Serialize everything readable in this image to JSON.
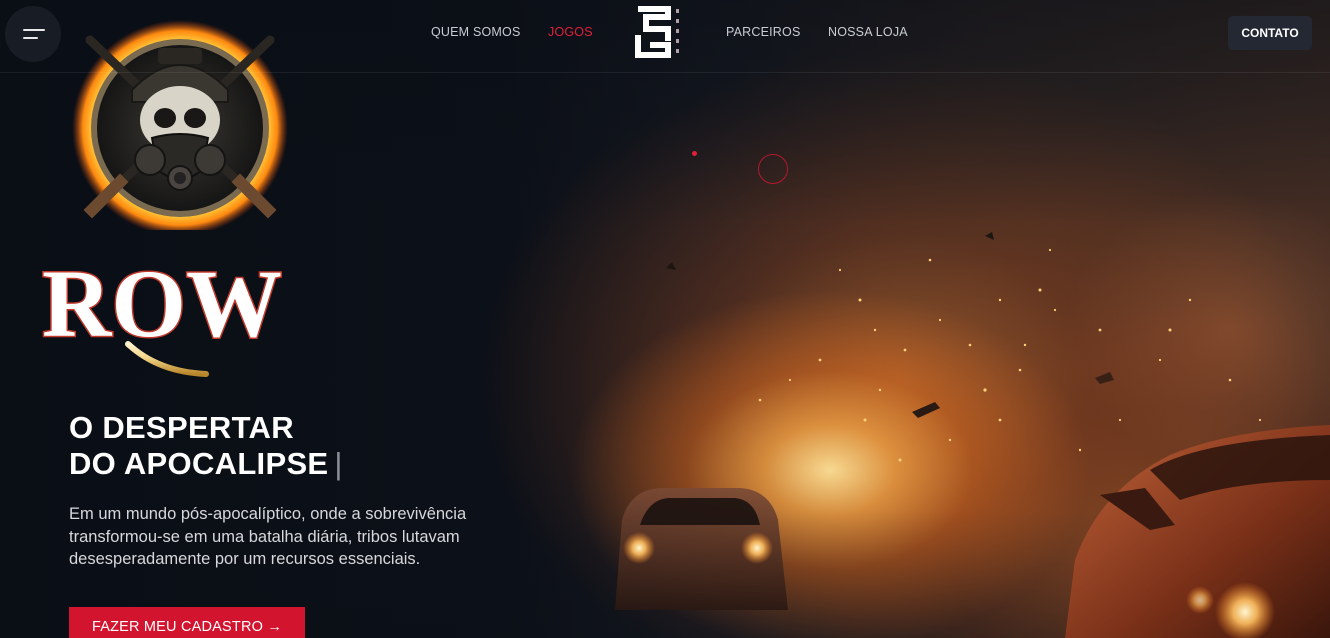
{
  "header": {
    "menu_icon": "hamburger-menu-icon",
    "nav": [
      {
        "label": "QUEM SOMOS",
        "active": false
      },
      {
        "label": "JOGOS",
        "active": true
      },
      {
        "label": "PARCEIROS",
        "active": false
      },
      {
        "label": "NOSSA LOJA",
        "active": false
      }
    ],
    "brand_icon": "gs-logo-icon",
    "contact_label": "CONTATO"
  },
  "hero": {
    "emblem_icon": "skull-gasmask-crossed-rifles-emblem",
    "game_logo_text": "ROW",
    "title_line1": "O DESPERTAR",
    "title_line2": "DO APOCALIPSE",
    "title_caret": "|",
    "description": "Em um mundo pós-apocalíptico, onde a sobrevivência transformou-se em uma batalha diária, tribos lutavam desesperadamente por um recursos essenciais.",
    "cta_label": "FAZER MEU CADASTRO →",
    "background": "burning-cars-explosion-scene"
  },
  "colors": {
    "accent": "#d3142f",
    "active_nav": "#e0203a",
    "background": "#0a0e15",
    "contact_button": "#242833"
  }
}
